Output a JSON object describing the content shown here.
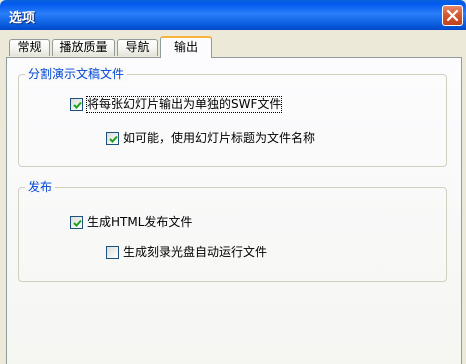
{
  "window": {
    "title": "选项",
    "close_icon": "close-icon",
    "colors": {
      "titlebar": "#0058ee",
      "close": "#d2562f",
      "dialog_bg": "#ece9d8",
      "group_caption": "#0046d5",
      "active_tab_highlight": "#f8b33a"
    }
  },
  "tabs": [
    {
      "label": "常规",
      "active": false
    },
    {
      "label": "播放质量",
      "active": false
    },
    {
      "label": "导航",
      "active": false
    },
    {
      "label": "输出",
      "active": true
    }
  ],
  "split_group": {
    "caption": "分割演示文稿文件",
    "options": [
      {
        "label": "将每张幻灯片输出为单独的SWF文件",
        "checked": true,
        "focused": true
      },
      {
        "label": "如可能，使用幻灯片标题为文件名称",
        "checked": true,
        "focused": false
      }
    ]
  },
  "publish_group": {
    "caption": "发布",
    "options": [
      {
        "label": "生成HTML发布文件",
        "checked": true,
        "focused": false
      },
      {
        "label": "生成刻录光盘自动运行文件",
        "checked": false,
        "focused": false
      }
    ]
  }
}
